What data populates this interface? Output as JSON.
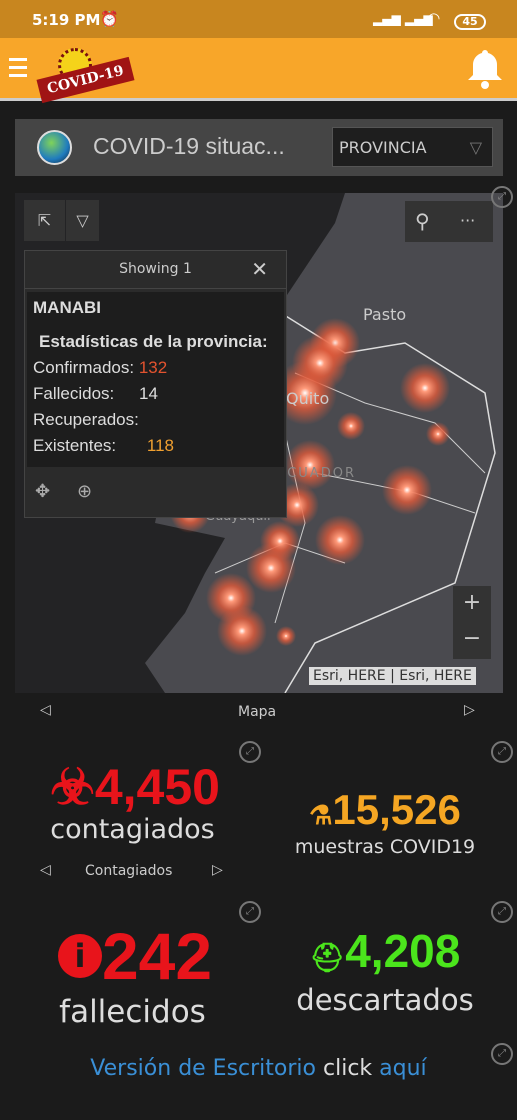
{
  "status_bar": {
    "time": "5:19 PM",
    "battery": "45"
  },
  "app_bar": {
    "logo_text": "COVID-19"
  },
  "header": {
    "title": "COVID-19 situac...",
    "dropdown": "PROVINCIA"
  },
  "map": {
    "labels": {
      "pasto": "Pasto",
      "quito": "Quito",
      "ecuador": "ECUADOR",
      "guayaquil": "Guayaquil"
    },
    "attribution": "Esri, HERE | Esri, HERE",
    "zoom_in": "+",
    "zoom_out": "−",
    "popup": {
      "header": "Showing 1",
      "name": "MANABI",
      "subtitle": "Estadísticas de la provincia:",
      "confirmados_label": "Confirmados:",
      "confirmados": "132",
      "fallecidos_label": "Fallecidos:",
      "fallecidos": "14",
      "recuperados_label": "Recuperados:",
      "existentes_label": "Existentes:",
      "existentes": "118"
    }
  },
  "map_nav": {
    "label": "Mapa"
  },
  "stats": {
    "contagiados": {
      "value": "4,450",
      "label": "contagiados",
      "nav": "Contagiados",
      "color": "#e8141b"
    },
    "muestras": {
      "value": "15,526",
      "label": "muestras COVID19",
      "color": "#f5a623"
    },
    "fallecidos": {
      "value": "242",
      "label": "fallecidos",
      "color": "#e8141b"
    },
    "descartados": {
      "value": "4,208",
      "label": "descartados",
      "color": "#4be51c"
    }
  },
  "footer": {
    "link1": "Versión de Escritorio",
    "text": "click",
    "link2": "aquí",
    "link_color": "#3a8fd6"
  }
}
